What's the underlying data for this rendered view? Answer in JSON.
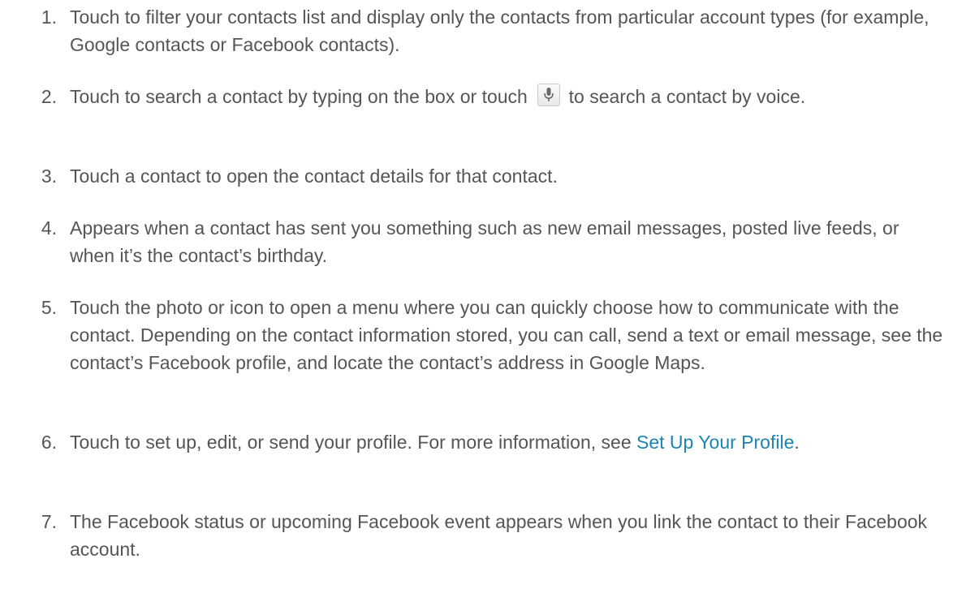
{
  "items": [
    {
      "number": "1.",
      "text": "Touch to filter your contacts list and display only the contacts from particular account types (for example, Google contacts or Facebook contacts)."
    },
    {
      "number": "2.",
      "text_before": "Touch to search a contact by typing on the box or touch",
      "text_after": "to search a contact by voice.",
      "icon": "microphone-icon"
    },
    {
      "number": "3.",
      "text": "Touch a contact to open the contact details for that contact."
    },
    {
      "number": "4.",
      "text": "Appears when a contact has sent you something such as new email messages, posted live feeds, or when it’s the contact’s birthday."
    },
    {
      "number": "5.",
      "text": "Touch the photo or icon to open a menu where you can quickly choose how to communicate with the contact. Depending on the contact information stored, you can call, send a text or email message, see the contact’s Facebook profile, and locate the contact’s address in Google Maps."
    },
    {
      "number": "6.",
      "text_before": "Touch to set up, edit, or send your profile. For more information, see",
      "link_text": "Set Up Your Profile",
      "text_after": "."
    },
    {
      "number": "7.",
      "text": "The Facebook status or upcoming Facebook event appears when you link the contact to their Facebook account."
    }
  ],
  "colors": {
    "text": "#555555",
    "link": "#1a85b3"
  }
}
